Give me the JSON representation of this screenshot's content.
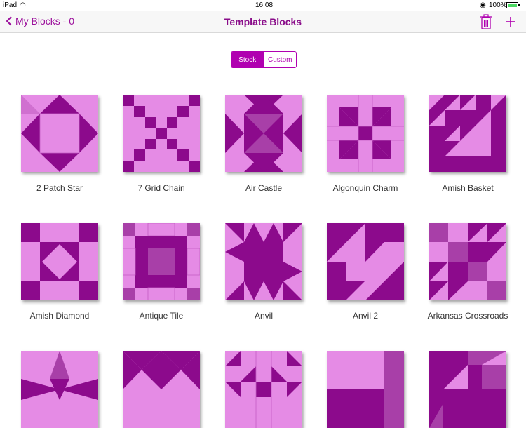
{
  "status_bar": {
    "device": "iPad",
    "time": "16:08",
    "battery": "100%"
  },
  "nav": {
    "back_label": "My Blocks - 0",
    "title": "Template Blocks"
  },
  "segmented": {
    "stock_label": "Stock",
    "custom_label": "Custom",
    "selected": "Stock"
  },
  "blocks": [
    {
      "name": "2 Patch Star"
    },
    {
      "name": "7 Grid Chain"
    },
    {
      "name": "Air Castle"
    },
    {
      "name": "Algonquin Charm"
    },
    {
      "name": "Amish Basket"
    },
    {
      "name": "Amish Diamond"
    },
    {
      "name": "Antique Tile"
    },
    {
      "name": "Anvil"
    },
    {
      "name": "Anvil 2"
    },
    {
      "name": "Arkansas Crossroads"
    },
    {
      "name": ""
    },
    {
      "name": ""
    },
    {
      "name": ""
    },
    {
      "name": ""
    },
    {
      "name": ""
    }
  ],
  "colors": {
    "accent": "#9b0f9b",
    "light": "#e58be5",
    "dark": "#8c0a8c",
    "mid": "#a83fa8"
  }
}
